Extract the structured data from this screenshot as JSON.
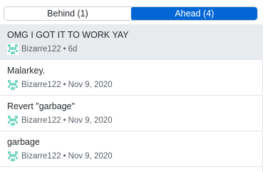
{
  "theme": {
    "accent": "#0366d6"
  },
  "tabs": {
    "behind_label": "Behind (1)",
    "ahead_label": "Ahead (4)"
  },
  "commits": [
    {
      "title": "OMG I GOT IT TO WORK YAY",
      "author": "Bizarre122",
      "separator": "•",
      "date": "6d",
      "selected": true
    },
    {
      "title": "Malarkey.",
      "author": "Bizarre122",
      "separator": "•",
      "date": "Nov 9, 2020"
    },
    {
      "title": "Revert \"garbage\"",
      "author": "Bizarre122",
      "separator": "•",
      "date": "Nov 9, 2020"
    },
    {
      "title": "garbage",
      "author": "Bizarre122",
      "separator": "•",
      "date": "Nov 9, 2020"
    }
  ]
}
